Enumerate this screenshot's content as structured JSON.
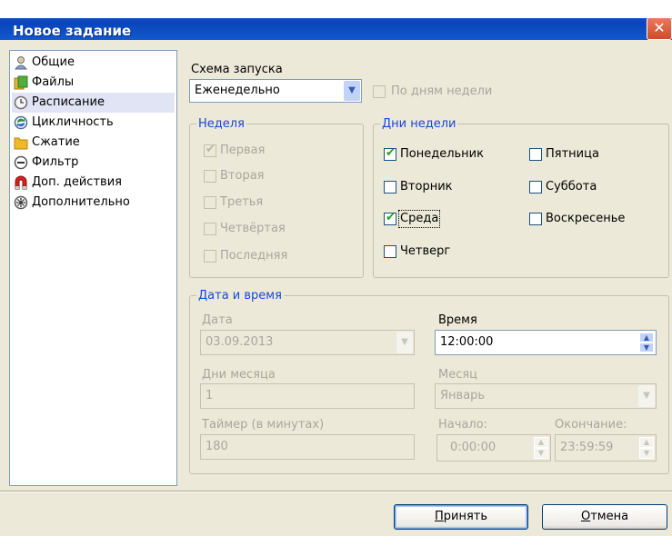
{
  "header": {
    "doc_text": "",
    "title": "Новое задание",
    "close": "✕"
  },
  "nav": {
    "items": [
      {
        "label": "Общие",
        "icon": "user-icon"
      },
      {
        "label": "Файлы",
        "icon": "folder-files-icon"
      },
      {
        "label": "Расписание",
        "icon": "clock-icon",
        "selected": true
      },
      {
        "label": "Цикличность",
        "icon": "cycle-icon"
      },
      {
        "label": "Сжатие",
        "icon": "folder-icon"
      },
      {
        "label": "Фильтр",
        "icon": "filter-icon"
      },
      {
        "label": "Доп. действия",
        "icon": "magnet-icon"
      },
      {
        "label": "Дополнительно",
        "icon": "gear-icon"
      }
    ]
  },
  "schedule": {
    "label": "Схема запуска",
    "value": "Еженедельно",
    "by_weekdays": {
      "label": "По дням недели",
      "checked": false,
      "enabled": false
    }
  },
  "week": {
    "legend": "Неделя",
    "items": [
      {
        "label": "Первая",
        "checked": true
      },
      {
        "label": "Вторая",
        "checked": false
      },
      {
        "label": "Третья",
        "checked": false
      },
      {
        "label": "Четвёртая",
        "checked": false
      },
      {
        "label": "Последняя",
        "checked": false
      }
    ]
  },
  "weekdays": {
    "legend": "Дни недели",
    "items": [
      {
        "label": "Понедельник",
        "checked": true
      },
      {
        "label": "Вторник",
        "checked": false
      },
      {
        "label": "Среда",
        "checked": true
      },
      {
        "label": "Четверг",
        "checked": false
      },
      {
        "label": "Пятница",
        "checked": false
      },
      {
        "label": "Суббота",
        "checked": false
      },
      {
        "label": "Воскресенье",
        "checked": false
      }
    ]
  },
  "datetime": {
    "legend": "Дата и время",
    "date": {
      "label": "Дата",
      "value": "03.09.2013"
    },
    "time": {
      "label": "Время",
      "value": "12:00:00"
    },
    "month_days": {
      "label": "Дни месяца",
      "value": "1"
    },
    "month": {
      "label": "Месяц",
      "value": "Январь"
    },
    "timer": {
      "label": "Таймер (в минутах)",
      "value": "180"
    },
    "start": {
      "label": "Начало:",
      "value": "0:00:00"
    },
    "end": {
      "label": "Окончание:",
      "value": "23:59:59"
    }
  },
  "buttons": {
    "accept": {
      "mnemonic": "П",
      "rest": "ринять"
    },
    "cancel": {
      "mnemonic": "О",
      "rest": "тмена"
    }
  },
  "colors": {
    "title_bar": "#0846b8",
    "legend_text": "#1846d6",
    "checkmark": "#21a121",
    "selected_nav": "#e1e4f5"
  }
}
